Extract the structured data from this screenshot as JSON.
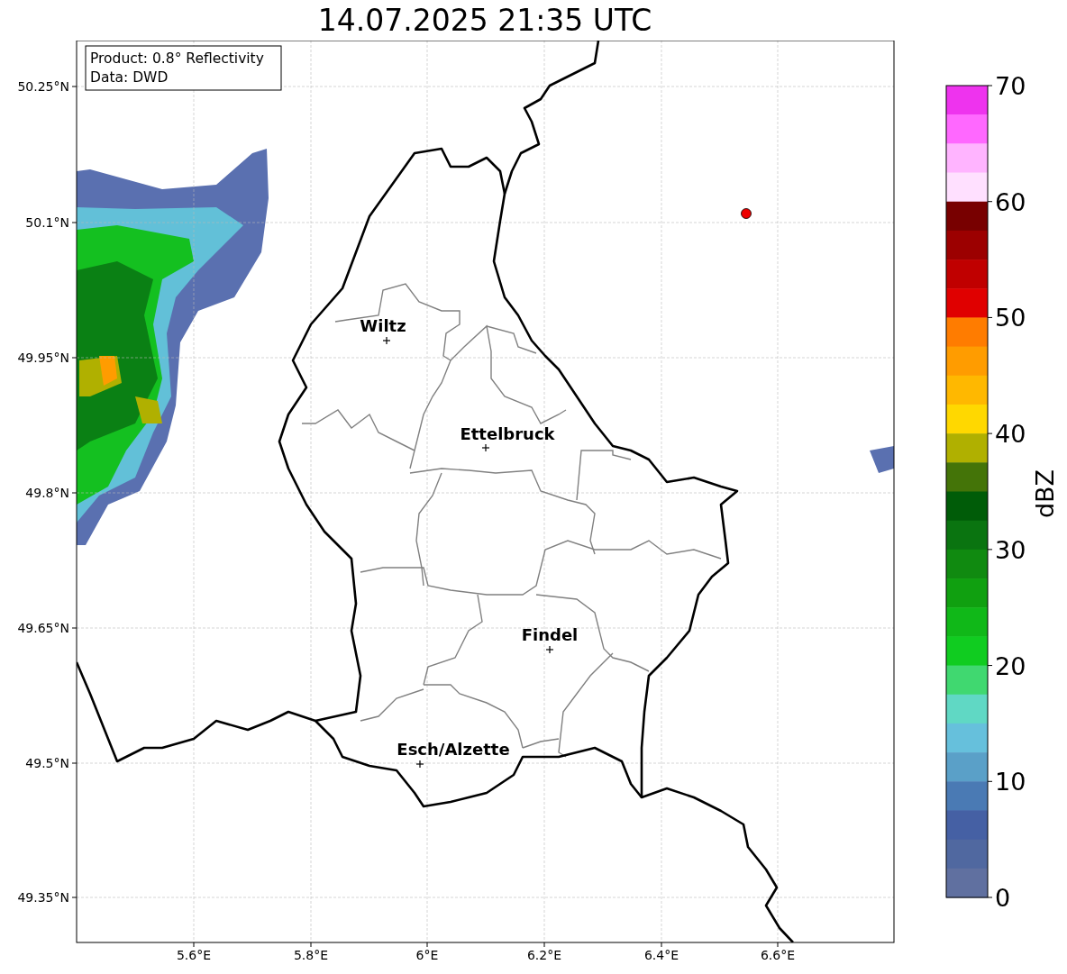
{
  "title": "14.07.2025 21:35 UTC",
  "legend": {
    "lines": [
      "Product: 0.8° Reflectivity",
      "Data: DWD"
    ]
  },
  "map": {
    "lat_ticks": [
      "50.25°N",
      "50.1°N",
      "49.95°N",
      "49.8°N",
      "49.65°N",
      "49.5°N",
      "49.35°N"
    ],
    "lon_ticks": [
      "5.6°E",
      "5.8°E",
      "6°E",
      "6.2°E",
      "6.4°E",
      "6.6°E"
    ],
    "places": [
      {
        "name": "Wiltz"
      },
      {
        "name": "Ettelbruck"
      },
      {
        "name": "Findel"
      },
      {
        "name": "Esch/Alzette"
      }
    ]
  },
  "colorbar": {
    "label": "dBZ",
    "ticks": [
      "70",
      "60",
      "50",
      "40",
      "30",
      "20",
      "10",
      "0"
    ],
    "bins": [
      {
        "color": "#ee33ee"
      },
      {
        "color": "#ff68ff"
      },
      {
        "color": "#ffb4ff"
      },
      {
        "color": "#ffe0ff"
      },
      {
        "color": "#780000"
      },
      {
        "color": "#9c0000"
      },
      {
        "color": "#c00000"
      },
      {
        "color": "#e00000"
      },
      {
        "color": "#ff7c00"
      },
      {
        "color": "#ff9c00"
      },
      {
        "color": "#ffb800"
      },
      {
        "color": "#ffd800"
      },
      {
        "color": "#b0b000"
      },
      {
        "color": "#447408"
      },
      {
        "color": "#005c08"
      },
      {
        "color": "#0a7410"
      },
      {
        "color": "#108a10"
      },
      {
        "color": "#10a010"
      },
      {
        "color": "#10b818"
      },
      {
        "color": "#10cc20"
      },
      {
        "color": "#40d870"
      },
      {
        "color": "#60d8c4"
      },
      {
        "color": "#66c0dc"
      },
      {
        "color": "#5aa0c8"
      },
      {
        "color": "#4a7ab4"
      },
      {
        "color": "#4560a4"
      },
      {
        "color": "#5068a0"
      },
      {
        "color": "#6070a0"
      }
    ]
  }
}
